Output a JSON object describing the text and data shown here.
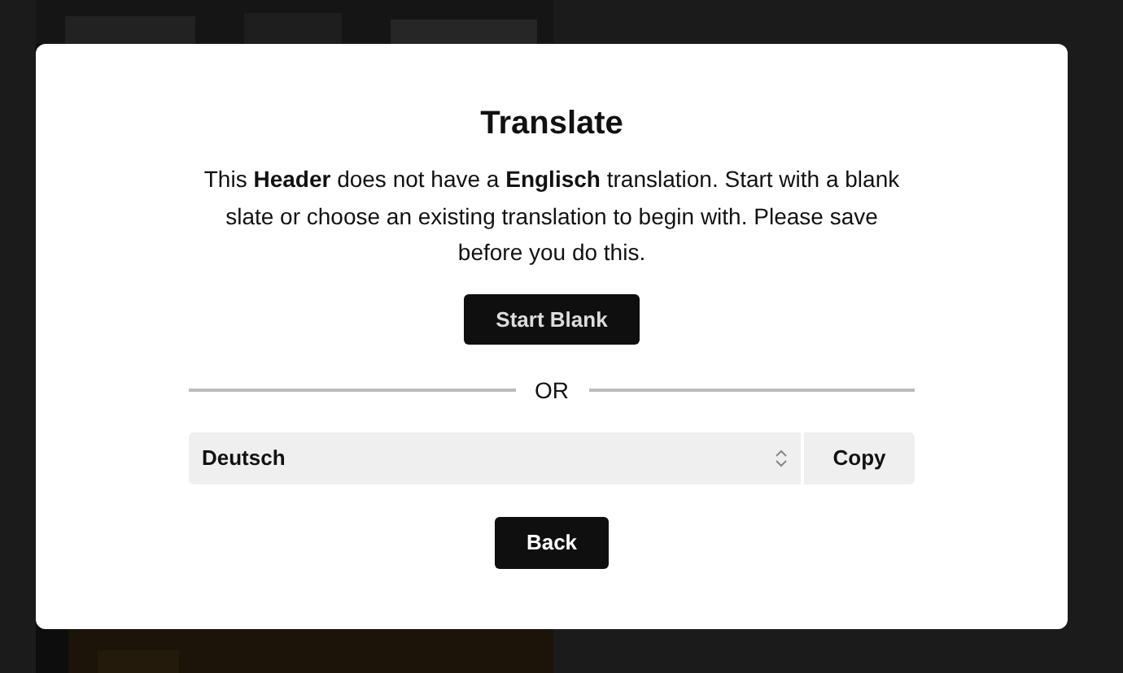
{
  "dialog": {
    "title": "Translate",
    "message": "This **Header** does not have a **Englisch** translation. Start with a blank slate or choose an existing translation to begin with. Please save before you do this.",
    "start_button": "Start Blank",
    "divider_label": "OR",
    "language_select": {
      "value": "Deutsch"
    },
    "copy_button": "Copy",
    "back_button": "Back"
  }
}
